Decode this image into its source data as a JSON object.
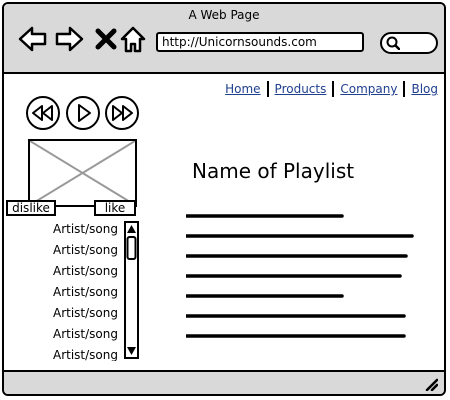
{
  "window": {
    "title": "A Web Page"
  },
  "browser": {
    "url": "http://Unicornsounds.com",
    "icons": [
      "back-arrow-icon",
      "forward-arrow-icon",
      "close-icon",
      "home-icon",
      "search-icon"
    ]
  },
  "nav": {
    "items": [
      {
        "label": "Home"
      },
      {
        "label": "Products"
      },
      {
        "label": "Company"
      },
      {
        "label": "Blog"
      }
    ]
  },
  "player": {
    "icons": [
      "rewind-icon",
      "play-icon",
      "fast-forward-icon"
    ],
    "dislike_label": "dislike",
    "like_label": "like"
  },
  "playlist": {
    "title": "Name of Playlist",
    "items": [
      {
        "label": "Artist/song"
      },
      {
        "label": "Artist/song"
      },
      {
        "label": "Artist/song"
      },
      {
        "label": "Artist/song"
      },
      {
        "label": "Artist/song"
      },
      {
        "label": "Artist/song"
      },
      {
        "label": "Artist/song"
      }
    ]
  },
  "colors": {
    "chrome": "#d9d9d9",
    "link": "#1f3f8f"
  }
}
